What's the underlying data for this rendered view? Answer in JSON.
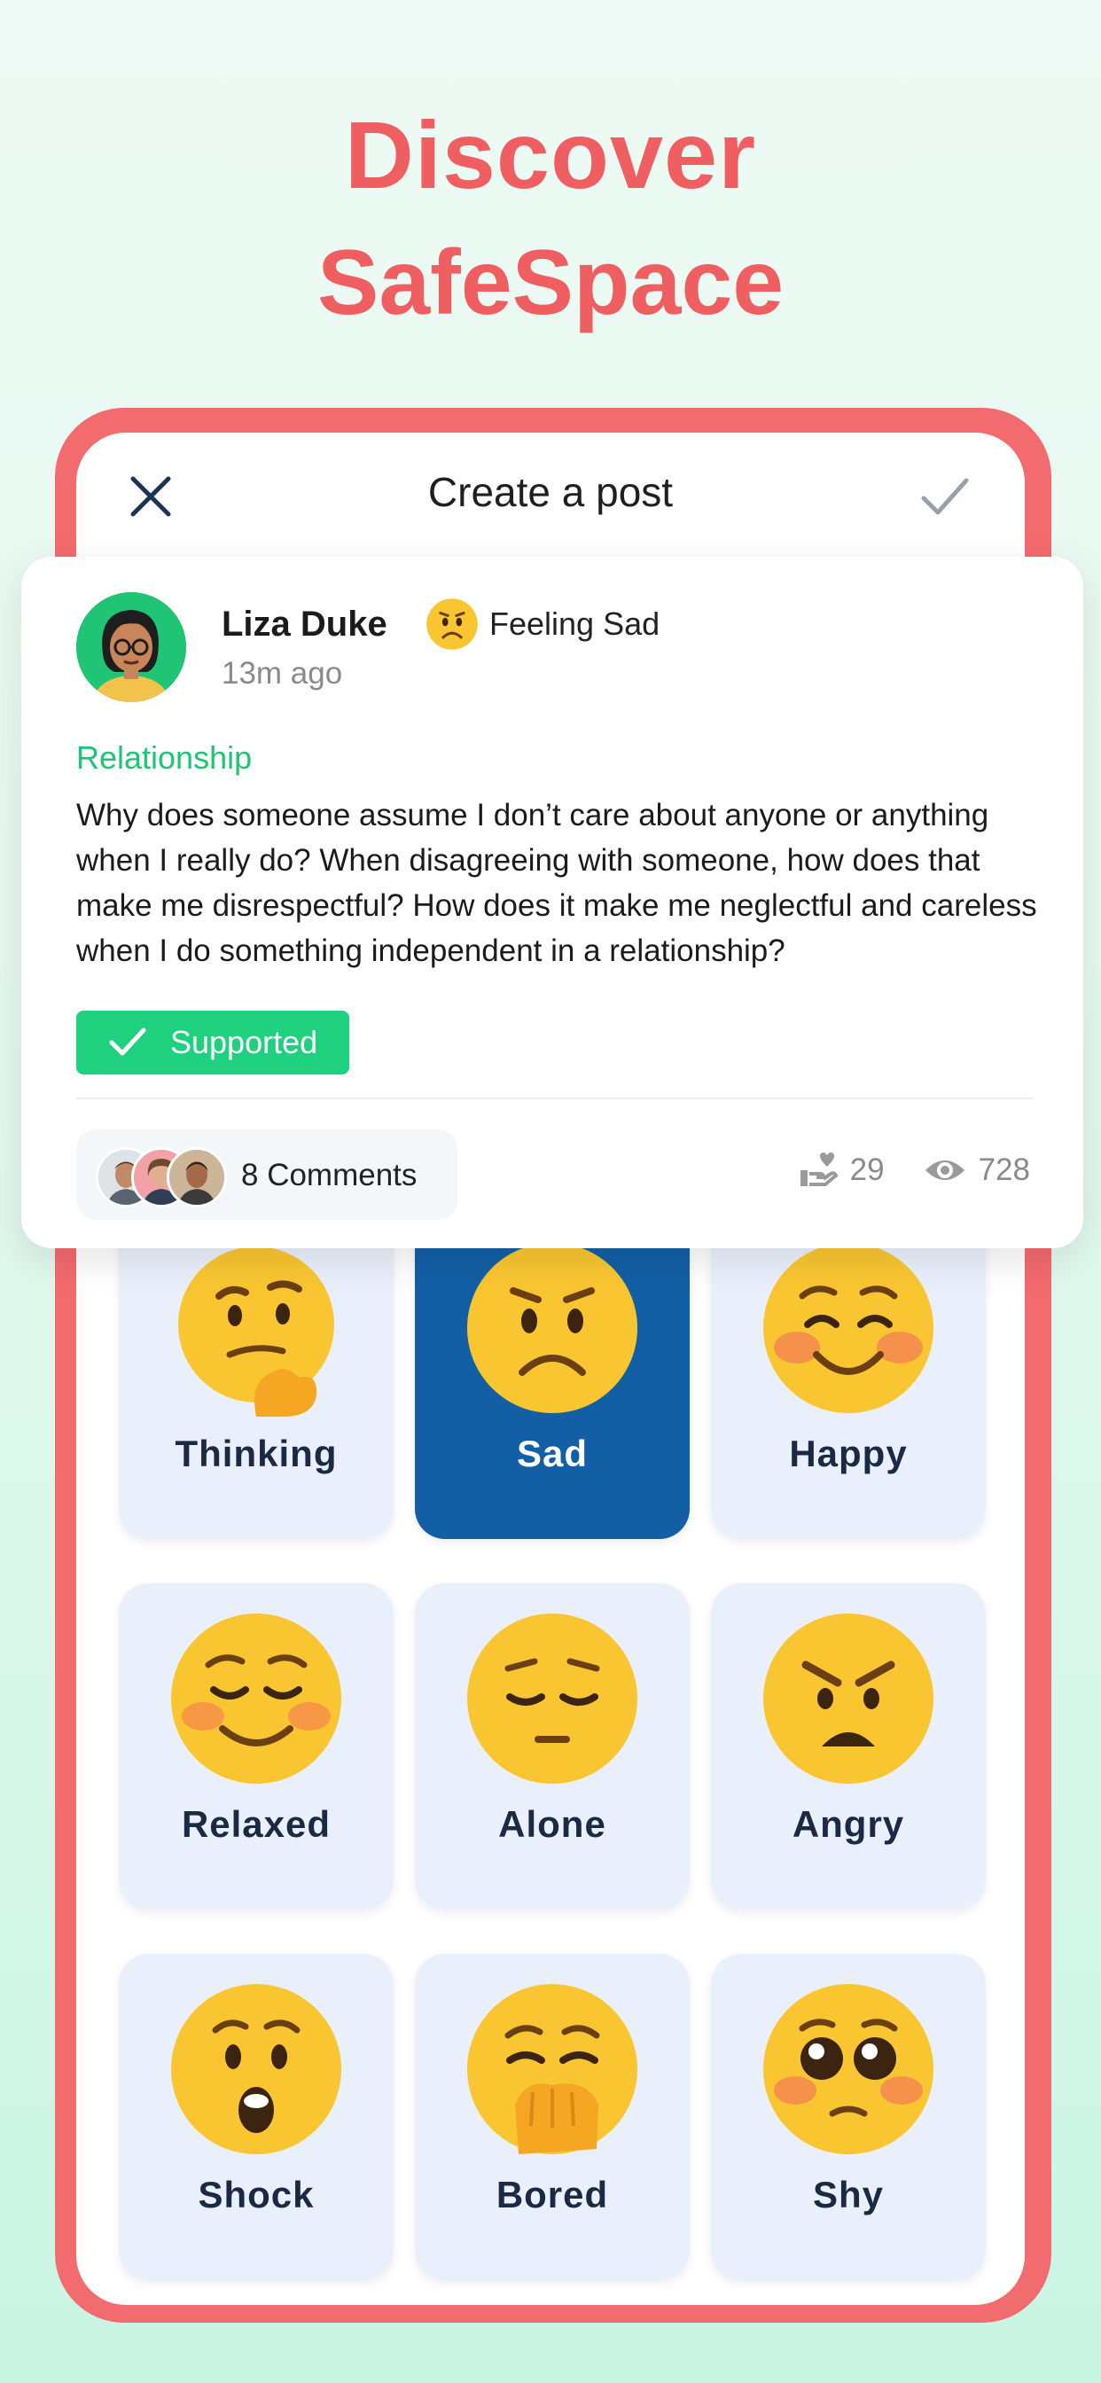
{
  "hero": {
    "line1": "Discover",
    "line2": "SafeSpace"
  },
  "topbar": {
    "title": "Create a post",
    "close_icon": "close-icon",
    "done_icon": "checkmark-icon"
  },
  "post": {
    "author": "Liza Duke",
    "time": "13m ago",
    "mood": "Feeling Sad",
    "category": "Relationship",
    "text": "Why does someone assume I don’t care about anyone or anything when I really do? When disagreeing with someone, how does that make me disrespectful? How does it make me neglectful and careless when I do something independent in a relationship?",
    "badge": "Supported",
    "comments": "8 Comments",
    "supports": "29",
    "views": "728"
  },
  "moods": [
    {
      "label": "Thinking",
      "icon": "thinking-face-icon"
    },
    {
      "label": "Sad",
      "icon": "sad-face-icon",
      "selected": true
    },
    {
      "label": "Happy",
      "icon": "happy-face-icon"
    },
    {
      "label": "Relaxed",
      "icon": "relaxed-face-icon"
    },
    {
      "label": "Alone",
      "icon": "pensive-face-icon"
    },
    {
      "label": "Angry",
      "icon": "angry-face-icon"
    },
    {
      "label": "Shock",
      "icon": "shocked-face-icon"
    },
    {
      "label": "Bored",
      "icon": "yawning-face-icon"
    },
    {
      "label": "Shy",
      "icon": "pleading-face-icon"
    }
  ],
  "colors": {
    "accent": "#ef5f62",
    "green": "#1fc575",
    "selected": "#135fa5"
  }
}
